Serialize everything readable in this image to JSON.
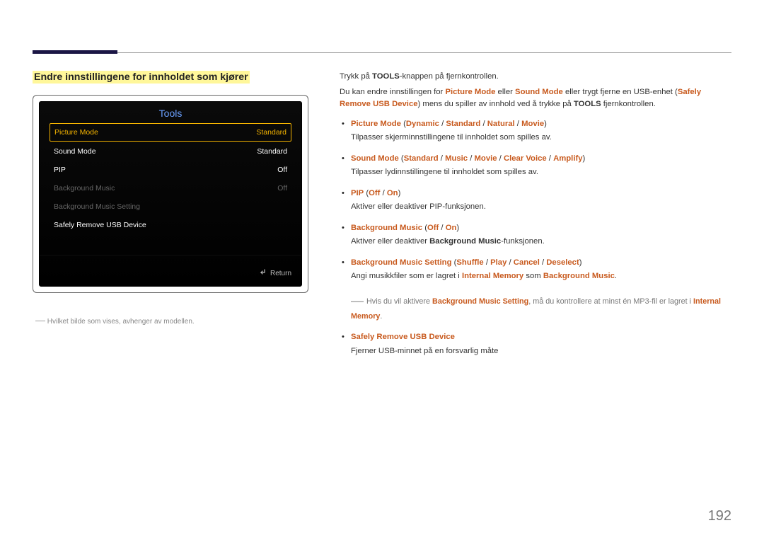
{
  "heading": "Endre innstillingene for innholdet som kjører",
  "screen": {
    "title": "Tools",
    "rows": [
      {
        "label": "Picture Mode",
        "value": "Standard",
        "sel": true
      },
      {
        "label": "Sound Mode",
        "value": "Standard"
      },
      {
        "label": "PIP",
        "value": "Off"
      },
      {
        "label": "Background Music",
        "value": "Off",
        "dim": true
      },
      {
        "label": "Background Music Setting",
        "value": "",
        "dim": true
      },
      {
        "label": "Safely Remove USB Device",
        "value": ""
      }
    ],
    "return": "Return"
  },
  "left_foot": {
    "dash": "―",
    "text": "Hvilket bilde som vises, avhenger av modellen."
  },
  "intro": {
    "p1a": "Trykk på ",
    "p1b": "TOOLS",
    "p1c": "-knappen på fjernkontrollen.",
    "p2a": "Du kan endre innstillingen for ",
    "pm": "Picture Mode",
    "p2b": " eller ",
    "sm": "Sound Mode",
    "p2c": " eller trygt fjerne en USB-enhet (",
    "sr": "Safely Remove USB Device",
    "p2d": ") mens du spiller av innhold ved å trykke på ",
    "p2e": "TOOLS",
    "p2f": " fjernkontrollen."
  },
  "items": {
    "i1": {
      "t": "Picture Mode",
      "o1": "Dynamic",
      "o2": "Standard",
      "o3": "Natural",
      "o4": "Movie",
      "d": "Tilpasser skjerminnstillingene til innholdet som spilles av."
    },
    "i2": {
      "t": "Sound Mode",
      "o1": "Standard",
      "o2": "Music",
      "o3": "Movie",
      "o4": "Clear Voice",
      "o5": "Amplify",
      "d": "Tilpasser lydinnstillingene til innholdet som spilles av."
    },
    "i3": {
      "t": "PIP",
      "o1": "Off",
      "o2": "On",
      "d": "Aktiver eller deaktiver PIP-funksjonen."
    },
    "i4": {
      "t": "Background Music",
      "o1": "Off",
      "o2": "On",
      "da": "Aktiver eller deaktiver ",
      "db": "Background Music",
      "dc": "-funksjonen."
    },
    "i5": {
      "t": "Background Music Setting",
      "o1": "Shuffle",
      "o2": "Play",
      "o3": "Cancel",
      "o4": "Deselect",
      "da": "Angi musikkfiler som er lagret i ",
      "im": "Internal Memory",
      "db": " som ",
      "bm": "Background Music",
      "dc": "."
    },
    "note": {
      "dash": "―",
      "a": "Hvis du vil aktivere ",
      "b": "Background Music Setting",
      "c": ", må du kontrollere at minst én MP3-fil er lagret i ",
      "d": "Internal Memory",
      "e": "."
    },
    "i6": {
      "t": "Safely Remove USB Device",
      "d": "Fjerner USB-minnet på en forsvarlig måte"
    }
  },
  "pagenum": "192"
}
